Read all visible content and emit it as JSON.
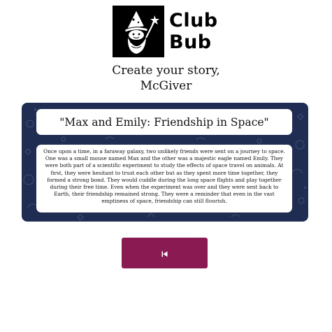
{
  "brand": {
    "name_line1": "Club",
    "name_line2": "Bub",
    "logo_icon": "wizard-icon"
  },
  "heading": {
    "line1": "Create your story,",
    "line2": "McGiver"
  },
  "story": {
    "title": "\"Max and Emily: Friendship in Space\"",
    "body": "Once upon a time, in a faraway galaxy, two unlikely friends were sent on a journey to space. One was a small mouse named Max and the other was a majestic eagle named Emily. They were both part of a scientific experiment to study the effects of space travel on animals. At first, they were hesitant to trust each other but as they spent more time together, they formed a strong bond. They would cuddle during the long space flights and play together during their free time. Even when the experiment was over and they were sent back to Earth, their friendship remained strong. They were a reminder that even in the vast emptiness of space, friendship can still flourish."
  },
  "controls": {
    "back_icon": "skip-back-icon",
    "back_color": "#8a1a52"
  },
  "colors": {
    "panel_bg": "#1f2d52",
    "card_bg": "#ffffff"
  }
}
